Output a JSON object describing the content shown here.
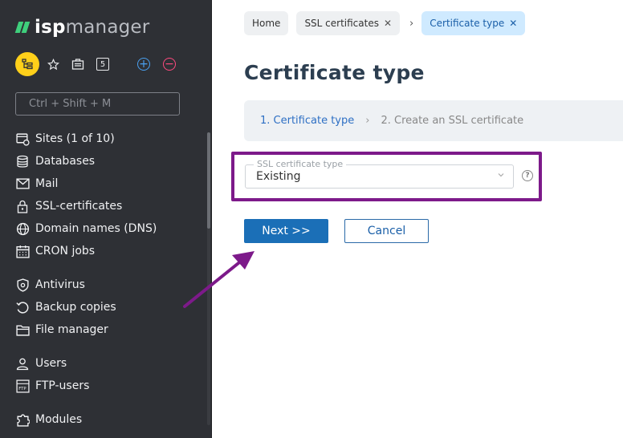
{
  "logo": {
    "bold": "isp",
    "light": "manager"
  },
  "toolbar": {
    "counter": "5"
  },
  "search": {
    "placeholder": "Ctrl + Shift + M"
  },
  "sidebar": {
    "items": [
      {
        "label": "Sites (1 of 10)",
        "icon": "sites-icon"
      },
      {
        "label": "Databases",
        "icon": "database-icon"
      },
      {
        "label": "Mail",
        "icon": "mail-icon"
      },
      {
        "label": "SSL-certificates",
        "icon": "lock-icon"
      },
      {
        "label": "Domain names (DNS)",
        "icon": "globe-icon"
      },
      {
        "label": "CRON jobs",
        "icon": "calendar-icon"
      },
      {
        "label": "Antivirus",
        "icon": "shield-icon"
      },
      {
        "label": "Backup copies",
        "icon": "backup-icon"
      },
      {
        "label": "File manager",
        "icon": "folder-icon"
      },
      {
        "label": "Users",
        "icon": "user-icon"
      },
      {
        "label": "FTP-users",
        "icon": "ftp-icon"
      },
      {
        "label": "Modules",
        "icon": "modules-icon"
      }
    ]
  },
  "breadcrumbs": [
    {
      "label": "Home"
    },
    {
      "label": "SSL certificates"
    },
    {
      "label": "Certificate type"
    }
  ],
  "page": {
    "title": "Certificate type"
  },
  "steps": {
    "step1": "1. Certificate type",
    "step2": "2. Create an SSL certificate"
  },
  "form": {
    "ssl_type_label": "SSL certificate type",
    "ssl_type_value": "Existing",
    "help": "?"
  },
  "buttons": {
    "next": "Next >>",
    "cancel": "Cancel"
  },
  "colors": {
    "highlight": "#7d1a8a",
    "primary": "#1b6fb7",
    "sidebar_bg": "#2e3035",
    "accent_yellow": "#ffd01a"
  }
}
